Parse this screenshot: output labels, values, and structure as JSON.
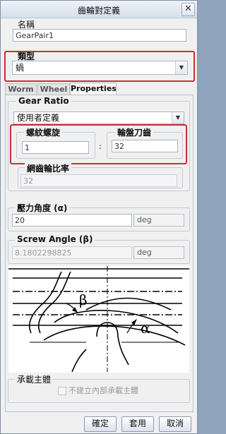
{
  "window": {
    "title": "齒輪對定義",
    "close_glyph": "✕"
  },
  "name": {
    "label": "名稱",
    "value": "GearPair1"
  },
  "type": {
    "label": "類型",
    "value": "蝸"
  },
  "tabs": [
    "Worm",
    "Wheel",
    "Properties"
  ],
  "gear_ratio": {
    "title": "Gear Ratio",
    "mode": "使用者定義",
    "worm_threads_label": "螺紋螺旋",
    "worm_threads_value": "1",
    "separator": ":",
    "wheel_teeth_label": "輪盤刀齒",
    "wheel_teeth_value": "32",
    "mesh_ratio_label": "網齒輪比率",
    "mesh_ratio_value": "32"
  },
  "pressure_angle": {
    "label": "壓力角度 (α)",
    "value": "20",
    "unit": "deg"
  },
  "screw_angle": {
    "label": "Screw Angle (β)",
    "value": "8.1802298825",
    "unit": "deg"
  },
  "diagram": {
    "beta": "β",
    "alpha": "α"
  },
  "bearing": {
    "title": "承載主體",
    "checkbox_label": "不建立內部承載主體",
    "checked": false
  },
  "buttons": {
    "ok": "確定",
    "apply": "套用",
    "cancel": "取消"
  },
  "colors": {
    "highlight": "#cc2e36"
  }
}
